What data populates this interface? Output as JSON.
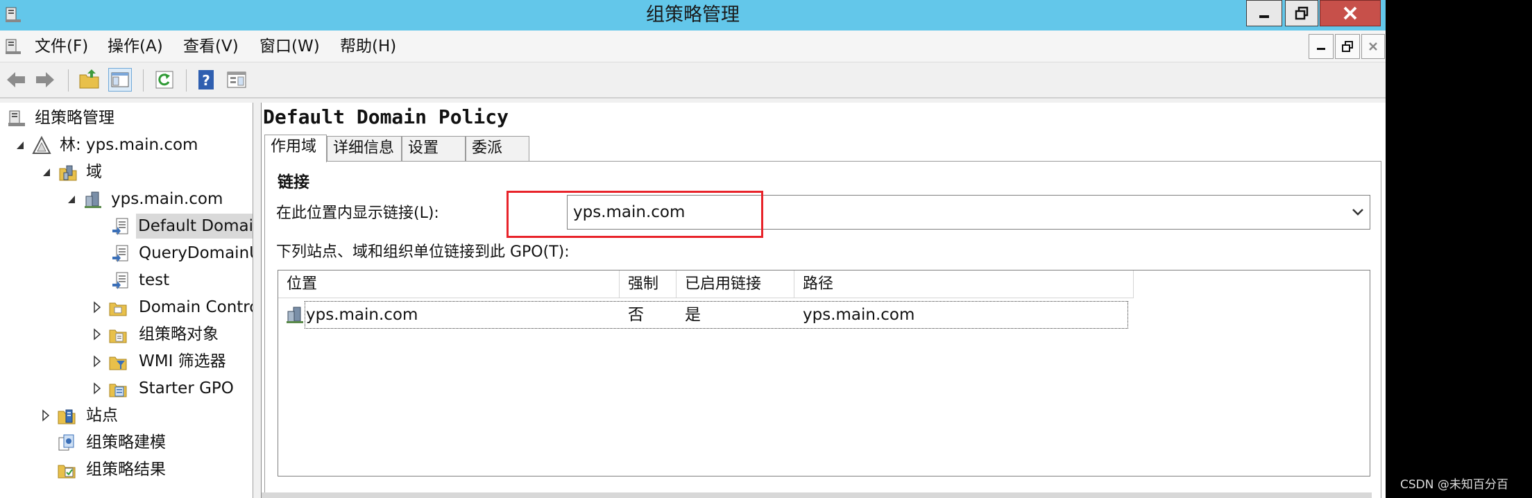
{
  "window": {
    "title": "组策略管理"
  },
  "menubar": {
    "items": [
      {
        "label": "文件(F)"
      },
      {
        "label": "操作(A)"
      },
      {
        "label": "查看(V)"
      },
      {
        "label": "窗口(W)"
      },
      {
        "label": "帮助(H)"
      }
    ]
  },
  "tree": {
    "root": "组策略管理",
    "forest": "林: yps.main.com",
    "domains": "域",
    "domain": "yps.main.com",
    "gpo_default": "Default Domain Policy",
    "gpo_query": "QueryDomainUsers",
    "gpo_test": "test",
    "domain_controllers": "Domain Controllers",
    "gpo_objects": "组策略对象",
    "wmi_filters": "WMI 筛选器",
    "starter_gpo": "Starter GPO",
    "sites": "站点",
    "modeling": "组策略建模",
    "results": "组策略结果"
  },
  "content": {
    "title": "Default Domain Policy",
    "tabs": [
      {
        "label": "作用域"
      },
      {
        "label": "详细信息"
      },
      {
        "label": "设置"
      },
      {
        "label": "委派"
      }
    ],
    "links_title": "链接",
    "location_label": "在此位置内显示链接(L):",
    "location_value": "yps.main.com",
    "linked_label": "下列站点、域和组织单位链接到此 GPO(T):",
    "columns": [
      "位置",
      "强制",
      "已启用链接",
      "路径"
    ],
    "rows": [
      {
        "location": "yps.main.com",
        "enforced": "否",
        "enabled": "是",
        "path": "yps.main.com"
      }
    ]
  },
  "watermark": "CSDN @未知百分百",
  "colors": {
    "titlebar": "#63c7ea",
    "close": "#c7504a",
    "highlight": "#e8232a"
  }
}
